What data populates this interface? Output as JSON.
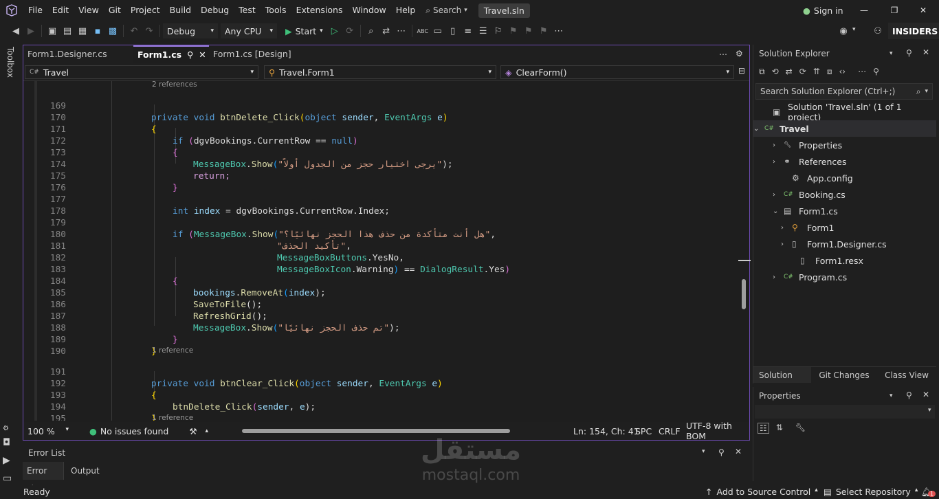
{
  "menu": [
    "File",
    "Edit",
    "View",
    "Git",
    "Project",
    "Build",
    "Debug",
    "Test",
    "Tools",
    "Extensions",
    "Window",
    "Help"
  ],
  "search_label": "Search",
  "solution_badge": "Travel.sln",
  "sign_in": "Sign in",
  "toolbar": {
    "config": "Debug",
    "platform": "Any CPU",
    "start": "Start",
    "insiders": "INSIDERS"
  },
  "toolbox_label": "Toolbox",
  "tabs": [
    {
      "label": "Form1.Designer.cs",
      "active": false
    },
    {
      "label": "Form1.cs",
      "active": true
    },
    {
      "label": "Form1.cs [Design]",
      "active": false
    }
  ],
  "nav": {
    "project": "Travel",
    "class": "Travel.Form1",
    "member": "ClearForm()"
  },
  "code": {
    "lens1": "2 references",
    "lens2": "1 reference",
    "lens3": "1 reference",
    "line_numbers": [
      "169",
      "170",
      "171",
      "172",
      "173",
      "174",
      "175",
      "176",
      "177",
      "178",
      "179",
      "180",
      "181",
      "182",
      "183",
      "184",
      "185",
      "186",
      "187",
      "188",
      "189",
      "190",
      "191",
      "192",
      "193",
      "194",
      "195"
    ],
    "l169": [
      "private void ",
      "btnDelete_Click",
      "(",
      "object ",
      "sender",
      ", ",
      "EventArgs ",
      "e",
      ")"
    ],
    "l170": "{",
    "l171": [
      "if ",
      "(",
      "dgvBookings",
      ".",
      "CurrentRow",
      " == ",
      "null",
      ")"
    ],
    "l172": "{",
    "l173": [
      "MessageBox",
      ".",
      "Show",
      "(",
      "\"يرجى اختيار حجز من الجدول أولاً\"",
      ");"
    ],
    "l174": "return;",
    "l175": "}",
    "l177": [
      "int ",
      "index",
      " = dgvBookings.",
      "CurrentRow",
      ".",
      "Index",
      ";"
    ],
    "l179": [
      "if ",
      "(",
      "MessageBox",
      ".",
      "Show",
      "(",
      "\"هل أنت متأكدة من حذف هذا الحجز نهائيًا؟\"",
      ","
    ],
    "l180": [
      "\"تأكيد الحذف\"",
      ","
    ],
    "l181": [
      "MessageBoxButtons",
      ".",
      "YesNo",
      ","
    ],
    "l182": [
      "MessageBoxIcon",
      ".",
      "Warning",
      ")",
      " == ",
      "DialogResult",
      ".",
      "Yes",
      ")"
    ],
    "l183": "{",
    "l184": [
      "bookings",
      ".",
      "RemoveAt",
      "(",
      "index",
      ");"
    ],
    "l185": [
      "SaveToFile",
      "();"
    ],
    "l186": [
      "RefreshGrid",
      "();"
    ],
    "l187": [
      "MessageBox",
      ".",
      "Show",
      "(",
      "\"تم حذف الحجز نهائيًا\"",
      ");"
    ],
    "l188": "}",
    "l189": "}",
    "l191": [
      "private void ",
      "btnClear_Click",
      "(",
      "object ",
      "sender",
      ", ",
      "EventArgs ",
      "e",
      ")"
    ],
    "l192": "{",
    "l193": [
      "btnDelete_Click",
      "(",
      "sender",
      ", ",
      "e",
      ");"
    ],
    "l194": "}"
  },
  "editor_status": {
    "zoom": "100 %",
    "issues": "No issues found",
    "position": "Ln: 154, Ch: 41",
    "spc": "SPC",
    "eol": "CRLF",
    "encoding": "UTF-8 with BOM"
  },
  "error_list": {
    "title": "Error List",
    "tabs": [
      "Error List",
      "Output"
    ]
  },
  "solution_explorer": {
    "title": "Solution Explorer",
    "search_placeholder": "Search Solution Explorer (Ctrl+;)",
    "tree": [
      {
        "label": "Solution 'Travel.sln' (1 of 1 project)",
        "icon": "solution-icon",
        "expander": ""
      },
      {
        "label": "Travel",
        "icon": "csproj-icon",
        "expander": "v"
      },
      {
        "label": "Properties",
        "icon": "wrench-icon",
        "expander": ">"
      },
      {
        "label": "References",
        "icon": "references-icon",
        "expander": ">"
      },
      {
        "label": "App.config",
        "icon": "config-icon",
        "expander": ""
      },
      {
        "label": "Booking.cs",
        "icon": "csharp-icon",
        "expander": ">"
      },
      {
        "label": "Form1.cs",
        "icon": "form-icon",
        "expander": "v"
      },
      {
        "label": "Form1",
        "icon": "class-icon",
        "expander": ">"
      },
      {
        "label": "Form1.Designer.cs",
        "icon": "file-icon",
        "expander": ">"
      },
      {
        "label": "Form1.resx",
        "icon": "file-icon",
        "expander": ""
      },
      {
        "label": "Program.cs",
        "icon": "csharp-icon",
        "expander": ">"
      }
    ],
    "bottom_tabs": [
      "Solution Ex...",
      "Git Changes",
      "Class View"
    ]
  },
  "properties": {
    "title": "Properties"
  },
  "status": {
    "ready": "Ready",
    "source_control": "Add to Source Control",
    "select_repo": "Select Repository",
    "notifications": "1"
  },
  "watermark": {
    "arabic": "مستقل",
    "latin": "mostaql.com"
  },
  "colors": {
    "accent": "#6d4bb3",
    "keyword": "#569cd6",
    "type": "#4ec9b0",
    "method": "#dcdcaa",
    "string": "#d69d85",
    "param": "#9cdcfe"
  }
}
